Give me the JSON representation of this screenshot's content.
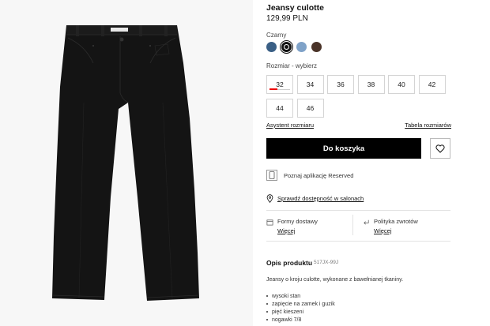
{
  "product": {
    "name": "Jeansy culotte",
    "price": "129,99 PLN",
    "color_name": "Czarny",
    "colors": [
      {
        "name": "blue-denim",
        "hex": "#3a5f85",
        "selected": false
      },
      {
        "name": "black",
        "hex": "#111111",
        "selected": true
      },
      {
        "name": "light-blue",
        "hex": "#7fa2c8",
        "selected": false
      },
      {
        "name": "brown",
        "hex": "#4a3328",
        "selected": false
      }
    ],
    "size_label": "Rozmiar -  wybierz",
    "sizes": [
      "32",
      "34",
      "36",
      "38",
      "40",
      "42",
      "44",
      "46"
    ],
    "size_guide_link": "Asystent rozmiaru",
    "size_table_link": "Tabela rozmiarów",
    "add_to_cart": "Do koszyka",
    "app_promo": "Poznaj aplikację Reserved",
    "availability_link": "Sprawdź dostępność w salonach",
    "delivery": {
      "label": "Formy dostawy",
      "more": "Więcej"
    },
    "returns": {
      "label": "Polityka zwrotów",
      "more": "Więcej"
    },
    "description_title": "Opis produktu",
    "product_code": "517JX-99J",
    "description": "Jeansy o kroju culotte, wykonane z bawełnianej tkaniny.",
    "features": [
      "wysoki stan",
      "zapięcie na zamek i guzik",
      "pięć kieszeni",
      "nogawki 7/8"
    ]
  },
  "accent_colors": {
    "button_bg": "#000000",
    "low_stock": "#e00000"
  }
}
